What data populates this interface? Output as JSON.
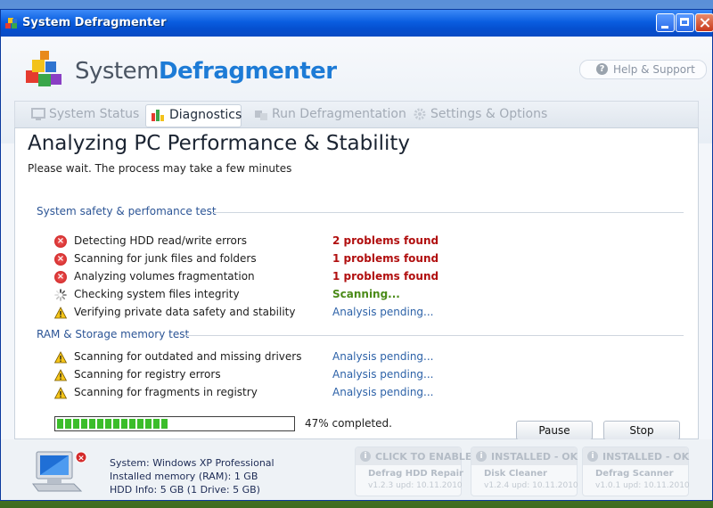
{
  "window": {
    "title": "System Defragmenter"
  },
  "brand": {
    "part1": "System",
    "part2": "Defragmenter"
  },
  "help": {
    "label": "Help & Support"
  },
  "tabs": [
    {
      "label": "System Status",
      "icon": "monitor-icon",
      "active": false
    },
    {
      "label": "Diagnostics",
      "icon": "bar-chart-icon",
      "active": true
    },
    {
      "label": "Run Defragmentation",
      "icon": "defrag-icon",
      "active": false
    },
    {
      "label": "Settings & Options",
      "icon": "gear-icon",
      "active": false
    }
  ],
  "main": {
    "heading": "Analyzing PC Performance & Stability",
    "subheading": "Please wait. The process may take a few minutes",
    "sections": [
      {
        "title": "System safety & perfomance test",
        "items": [
          {
            "label": "Detecting HDD read/write errors",
            "status": "2 problems found",
            "state": "error"
          },
          {
            "label": "Scanning for junk files and folders",
            "status": "1 problems found",
            "state": "error"
          },
          {
            "label": "Analyzing volumes fragmentation",
            "status": "1 problems found",
            "state": "error"
          },
          {
            "label": "Checking system files integrity",
            "status": "Scanning...",
            "state": "scanning"
          },
          {
            "label": "Verifying private data safety and stability",
            "status": "Analysis pending...",
            "state": "pending"
          }
        ]
      },
      {
        "title": "RAM & Storage memory test",
        "items": [
          {
            "label": "Scanning for outdated and missing drivers",
            "status": "Analysis pending...",
            "state": "pending"
          },
          {
            "label": "Scanning for registry errors",
            "status": "Analysis pending...",
            "state": "pending"
          },
          {
            "label": "Scanning for fragments in registry",
            "status": "Analysis pending...",
            "state": "pending"
          }
        ]
      }
    ],
    "progress": {
      "fraction": 0.47,
      "label": "47% completed."
    },
    "buttons": {
      "pause": "Pause",
      "stop": "Stop"
    }
  },
  "footer": {
    "system": "System: Windows XP Professional",
    "memory": "Installed memory (RAM): 1 GB",
    "hdd": "HDD Info: 5 GB (1 Drive: 5 GB)",
    "cards": [
      {
        "status": "CLICK TO ENABLE",
        "name": "Defrag HDD Repair",
        "version": "v1.2.3 upd: 10.11.2010"
      },
      {
        "status": "INSTALLED - OK",
        "name": "Disk Cleaner",
        "version": "v1.2.4 upd: 10.11.2010"
      },
      {
        "status": "INSTALLED - OK",
        "name": "Defrag Scanner",
        "version": "v1.0.1 upd: 10.11.2010"
      }
    ]
  },
  "colors": {
    "error": "#b10f0f",
    "scanning": "#4b8b18",
    "pending": "#2d62a8",
    "accent": "#1d7bd6"
  }
}
